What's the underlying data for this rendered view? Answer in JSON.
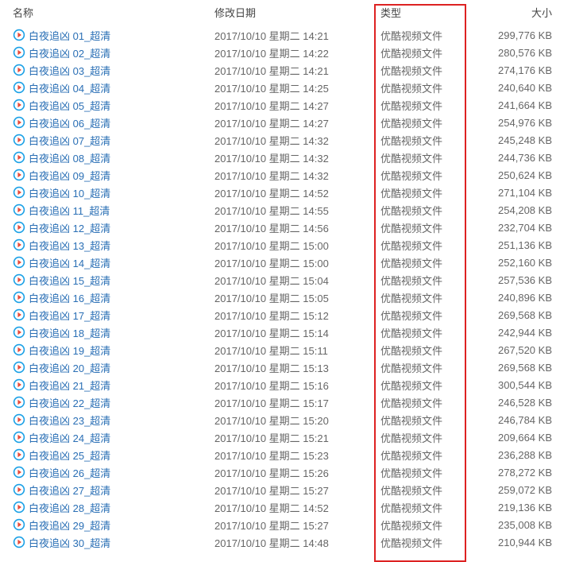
{
  "columns": {
    "name": "名称",
    "date": "修改日期",
    "type": "类型",
    "size": "大小"
  },
  "file_type_label": "优酷视频文件",
  "files": [
    {
      "name": "白夜追凶 01_超清",
      "date": "2017/10/10 星期二 14:21",
      "size": "299,776 KB"
    },
    {
      "name": "白夜追凶 02_超清",
      "date": "2017/10/10 星期二 14:22",
      "size": "280,576 KB"
    },
    {
      "name": "白夜追凶 03_超清",
      "date": "2017/10/10 星期二 14:21",
      "size": "274,176 KB"
    },
    {
      "name": "白夜追凶 04_超清",
      "date": "2017/10/10 星期二 14:25",
      "size": "240,640 KB"
    },
    {
      "name": "白夜追凶 05_超清",
      "date": "2017/10/10 星期二 14:27",
      "size": "241,664 KB"
    },
    {
      "name": "白夜追凶 06_超清",
      "date": "2017/10/10 星期二 14:27",
      "size": "254,976 KB"
    },
    {
      "name": "白夜追凶 07_超清",
      "date": "2017/10/10 星期二 14:32",
      "size": "245,248 KB"
    },
    {
      "name": "白夜追凶 08_超清",
      "date": "2017/10/10 星期二 14:32",
      "size": "244,736 KB"
    },
    {
      "name": "白夜追凶 09_超清",
      "date": "2017/10/10 星期二 14:32",
      "size": "250,624 KB"
    },
    {
      "name": "白夜追凶 10_超清",
      "date": "2017/10/10 星期二 14:52",
      "size": "271,104 KB"
    },
    {
      "name": "白夜追凶 11_超清",
      "date": "2017/10/10 星期二 14:55",
      "size": "254,208 KB"
    },
    {
      "name": "白夜追凶 12_超清",
      "date": "2017/10/10 星期二 14:56",
      "size": "232,704 KB"
    },
    {
      "name": "白夜追凶 13_超清",
      "date": "2017/10/10 星期二 15:00",
      "size": "251,136 KB"
    },
    {
      "name": "白夜追凶 14_超清",
      "date": "2017/10/10 星期二 15:00",
      "size": "252,160 KB"
    },
    {
      "name": "白夜追凶 15_超清",
      "date": "2017/10/10 星期二 15:04",
      "size": "257,536 KB"
    },
    {
      "name": "白夜追凶 16_超清",
      "date": "2017/10/10 星期二 15:05",
      "size": "240,896 KB"
    },
    {
      "name": "白夜追凶 17_超清",
      "date": "2017/10/10 星期二 15:12",
      "size": "269,568 KB"
    },
    {
      "name": "白夜追凶 18_超清",
      "date": "2017/10/10 星期二 15:14",
      "size": "242,944 KB"
    },
    {
      "name": "白夜追凶 19_超清",
      "date": "2017/10/10 星期二 15:11",
      "size": "267,520 KB"
    },
    {
      "name": "白夜追凶 20_超清",
      "date": "2017/10/10 星期二 15:13",
      "size": "269,568 KB"
    },
    {
      "name": "白夜追凶 21_超清",
      "date": "2017/10/10 星期二 15:16",
      "size": "300,544 KB"
    },
    {
      "name": "白夜追凶 22_超清",
      "date": "2017/10/10 星期二 15:17",
      "size": "246,528 KB"
    },
    {
      "name": "白夜追凶 23_超清",
      "date": "2017/10/10 星期二 15:20",
      "size": "246,784 KB"
    },
    {
      "name": "白夜追凶 24_超清",
      "date": "2017/10/10 星期二 15:21",
      "size": "209,664 KB"
    },
    {
      "name": "白夜追凶 25_超清",
      "date": "2017/10/10 星期二 15:23",
      "size": "236,288 KB"
    },
    {
      "name": "白夜追凶 26_超清",
      "date": "2017/10/10 星期二 15:26",
      "size": "278,272 KB"
    },
    {
      "name": "白夜追凶 27_超清",
      "date": "2017/10/10 星期二 15:27",
      "size": "259,072 KB"
    },
    {
      "name": "白夜追凶 28_超清",
      "date": "2017/10/10 星期二 14:52",
      "size": "219,136 KB"
    },
    {
      "name": "白夜追凶 29_超清",
      "date": "2017/10/10 星期二 15:27",
      "size": "235,008 KB"
    },
    {
      "name": "白夜追凶 30_超清",
      "date": "2017/10/10 星期二 14:48",
      "size": "210,944 KB"
    }
  ]
}
